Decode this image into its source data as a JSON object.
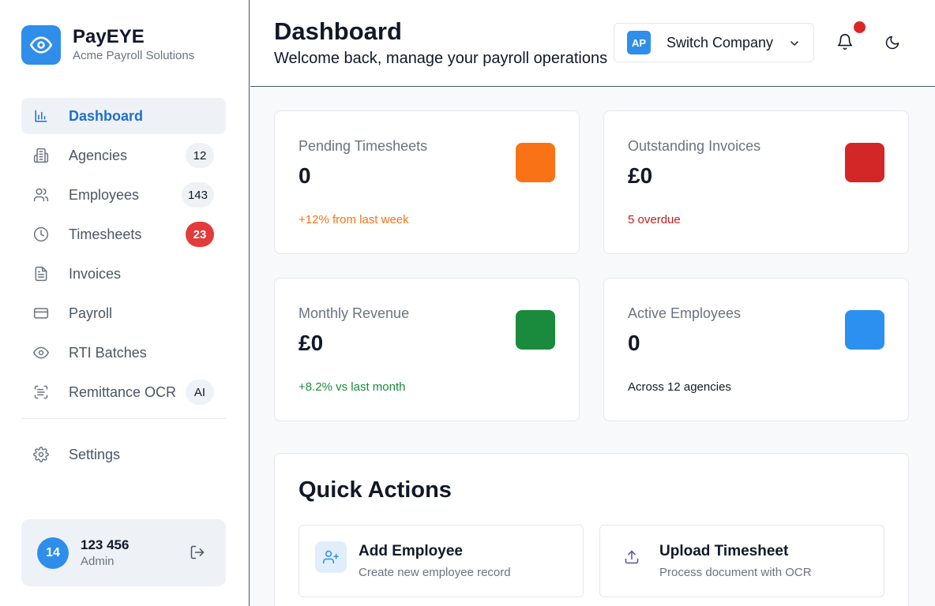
{
  "brand": {
    "name": "PayEYE",
    "subtitle": "Acme Payroll Solutions"
  },
  "sidebar": {
    "items": [
      {
        "label": "Dashboard",
        "icon": "bar-chart-icon",
        "active": true
      },
      {
        "label": "Agencies",
        "icon": "building-icon",
        "badge": "12"
      },
      {
        "label": "Employees",
        "icon": "users-icon",
        "badge": "143"
      },
      {
        "label": "Timesheets",
        "icon": "clock-icon",
        "badge": "23"
      },
      {
        "label": "Invoices",
        "icon": "file-text-icon"
      },
      {
        "label": "Payroll",
        "icon": "credit-card-icon"
      },
      {
        "label": "RTI Batches",
        "icon": "eye-icon"
      },
      {
        "label": "Remittance OCR",
        "icon": "scan-icon",
        "badge": "AI"
      },
      {
        "label": "Settings",
        "icon": "gear-icon"
      }
    ]
  },
  "user": {
    "initials": "14",
    "name": "123 456",
    "role": "Admin"
  },
  "header": {
    "title": "Dashboard",
    "subtitle": "Welcome back, manage your payroll operations",
    "company_initials": "AP",
    "switch_label": "Switch Company"
  },
  "cards": [
    {
      "label": "Pending Timesheets",
      "value": "0",
      "foot": "+12% from last week",
      "foot_color": "#f97316",
      "square_color": "#f97316"
    },
    {
      "label": "Outstanding Invoices",
      "value": "£0",
      "foot": "5 overdue",
      "foot_color": "#c81e1e",
      "square_color": "#d32626"
    },
    {
      "label": "Monthly Revenue",
      "value": "£0",
      "foot": "+8.2% vs last month",
      "foot_color": "#1a8a3c",
      "square_color": "#1a8a3c"
    },
    {
      "label": "Active Employees",
      "value": "0",
      "foot": "Across 12 agencies",
      "foot_color": "#111827",
      "square_color": "#2b90ef"
    }
  ],
  "quick_actions": {
    "title": "Quick Actions",
    "items": [
      {
        "name": "Add Employee",
        "desc": "Create new employee record",
        "icon": "user-plus-icon"
      },
      {
        "name": "Upload Timesheet",
        "desc": "Process document with OCR",
        "icon": "upload-icon"
      }
    ]
  },
  "colors": {
    "accent": "#2f8ee9",
    "active_nav": "#1d6fd1",
    "notification_dot": "#dc2626",
    "badge_red": "#e23b3b"
  }
}
